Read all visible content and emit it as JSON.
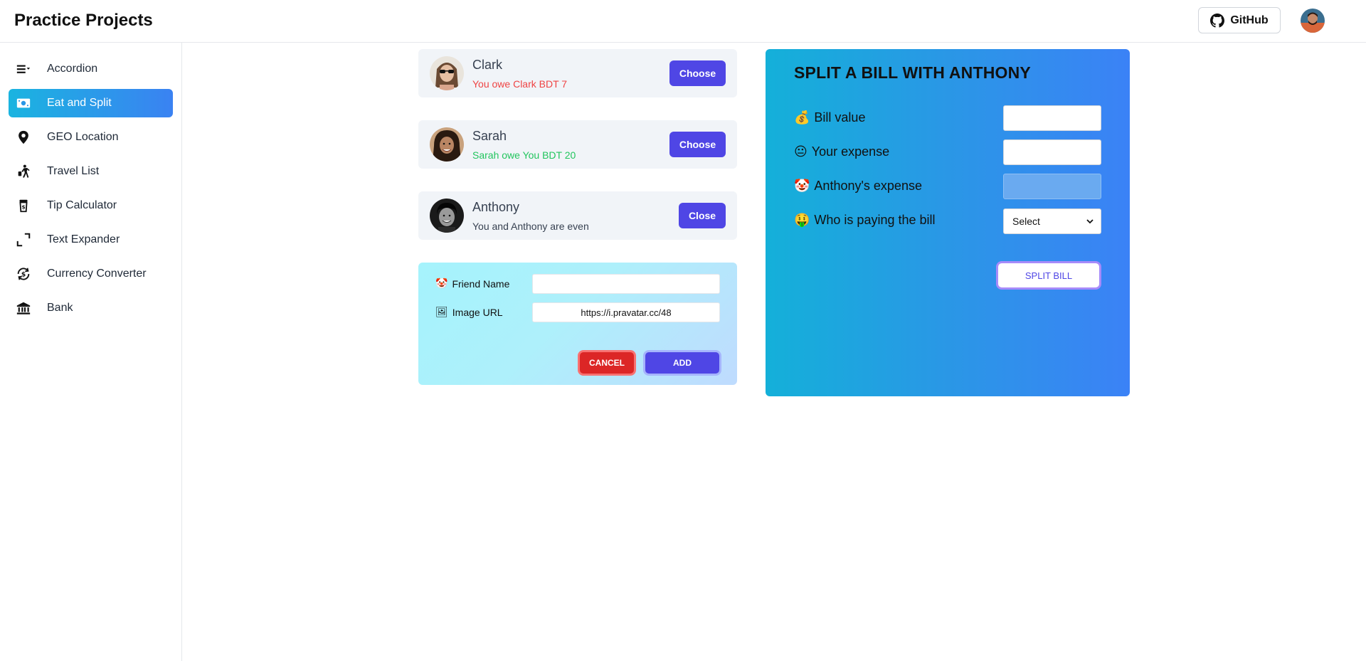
{
  "header": {
    "title": "Practice Projects",
    "github_label": "GitHub"
  },
  "sidebar": {
    "items": [
      {
        "label": "Accordion",
        "icon": "list-icon",
        "active": false
      },
      {
        "label": "Eat and Split",
        "icon": "money-icon",
        "active": true
      },
      {
        "label": "GEO Location",
        "icon": "map-pin-icon",
        "active": false
      },
      {
        "label": "Travel List",
        "icon": "traveler-icon",
        "active": false
      },
      {
        "label": "Tip Calculator",
        "icon": "tip-jar-icon",
        "active": false
      },
      {
        "label": "Text Expander",
        "icon": "expand-icon",
        "active": false
      },
      {
        "label": "Currency Converter",
        "icon": "currency-exchange-icon",
        "active": false
      },
      {
        "label": "Bank",
        "icon": "bank-icon",
        "active": false
      }
    ]
  },
  "friends": [
    {
      "name": "Clark",
      "status": "You owe Clark BDT 7",
      "status_color": "#ef4444",
      "button": "Choose"
    },
    {
      "name": "Sarah",
      "status": "Sarah owe You BDT 20",
      "status_color": "#22c55e",
      "button": "Choose"
    },
    {
      "name": "Anthony",
      "status": "You and Anthony are even",
      "status_color": "#374151",
      "button": "Close"
    }
  ],
  "add_friend": {
    "name_label": "Friend Name",
    "name_value": "",
    "image_label": "Image URL",
    "image_value": "https://i.pravatar.cc/48",
    "cancel_label": "CANCEL",
    "add_label": "ADD"
  },
  "split": {
    "title": "SPLIT A BILL WITH ANTHONY",
    "bill_label": "Bill value",
    "expense_label": "Your expense",
    "friend_expense_label": "Anthony's expense",
    "payer_label": "Who is paying the bill",
    "payer_selected": "Select",
    "button_label": "SPLIT BILL"
  },
  "colors": {
    "accent": "#4f46e5",
    "active_nav_start": "#1ab4e0",
    "active_nav_end": "#3a82f2",
    "danger": "#dc2626"
  }
}
